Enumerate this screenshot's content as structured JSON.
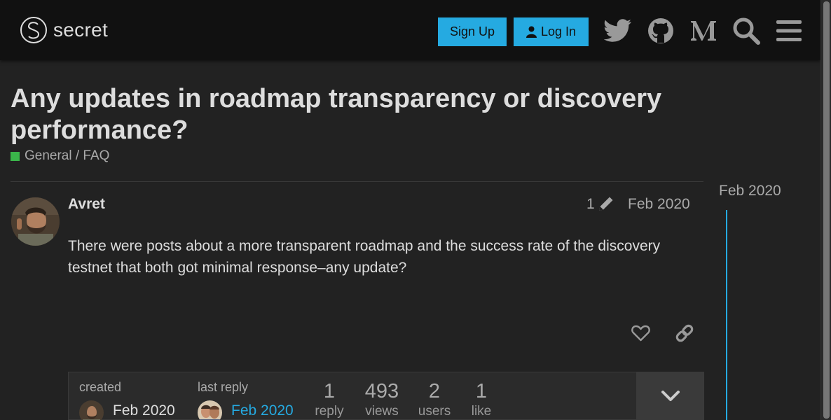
{
  "header": {
    "logo_text": "secret",
    "signup_label": "Sign Up",
    "login_label": "Log In",
    "icons": [
      "twitter-icon",
      "github-icon",
      "medium-icon",
      "search-icon",
      "hamburger-menu-icon"
    ]
  },
  "topic": {
    "title": "Any updates in roadmap transparency or discovery performance?",
    "category": "General / FAQ",
    "category_color": "#3ab54a"
  },
  "post": {
    "username": "Avret",
    "edit_count": "1",
    "date": "Feb 2020",
    "body": "There were posts about a more transparent roadmap and the success rate of the discovery testnet that both got minimal response–any update?"
  },
  "topic_map": {
    "created_label": "created",
    "created_date": "Feb 2020",
    "last_reply_label": "last reply",
    "last_reply_date": "Feb 2020",
    "stats": [
      {
        "num": "1",
        "label": "reply"
      },
      {
        "num": "493",
        "label": "views"
      },
      {
        "num": "2",
        "label": "users"
      },
      {
        "num": "1",
        "label": "like"
      }
    ]
  },
  "timeline": {
    "date": "Feb 2020"
  },
  "colors": {
    "accent": "#25aae1",
    "header_bg": "#111111",
    "page_bg": "#222222"
  }
}
